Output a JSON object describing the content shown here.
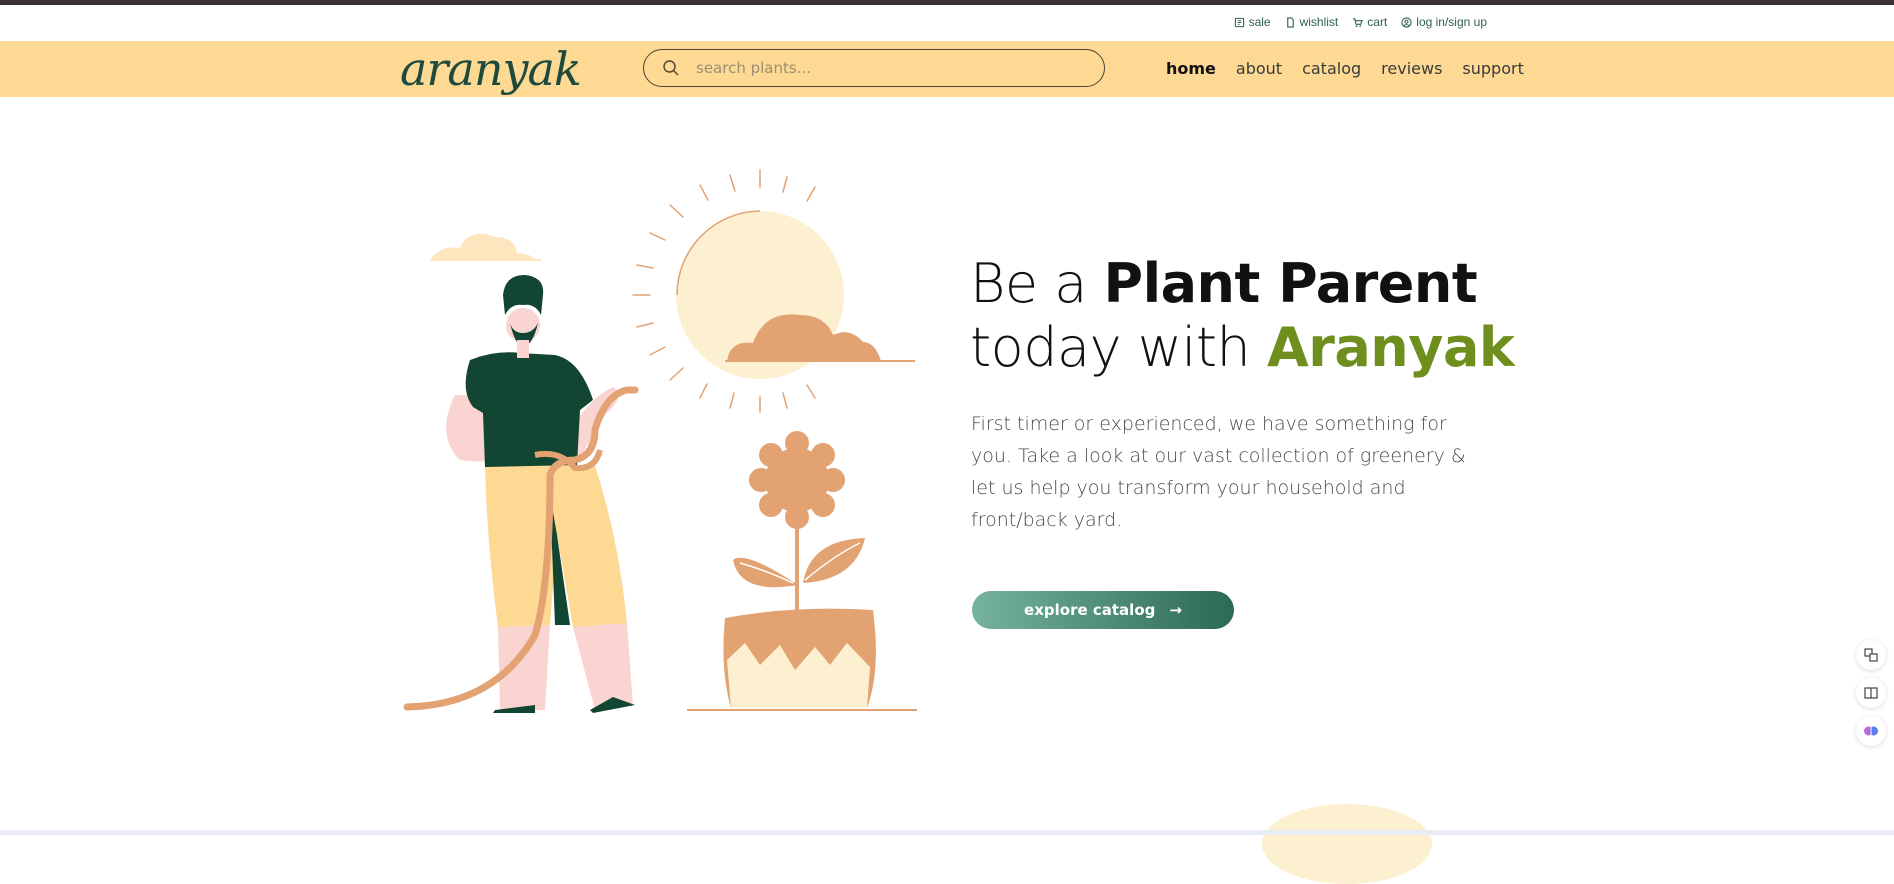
{
  "utility": {
    "links": [
      {
        "label": "sale",
        "icon": "tag-icon"
      },
      {
        "label": "wishlist",
        "icon": "document-icon"
      },
      {
        "label": "cart",
        "icon": "cart-icon"
      },
      {
        "label": "log in/sign up",
        "icon": "user-circle-icon"
      }
    ]
  },
  "navbar": {
    "logo": "aranyak",
    "search_placeholder": "search plants...",
    "links": [
      "home",
      "about",
      "catalog",
      "reviews",
      "support"
    ],
    "active": "home"
  },
  "hero": {
    "headline_line1_plain": "Be a ",
    "headline_line1_bold": "Plant Parent",
    "headline_line2_plain": "today with ",
    "headline_line2_brand": "Aranyak",
    "description": "First timer or experienced, we have something for you. Take a look at our vast collection of greenery & let us help you transform your household and front/back yard.",
    "cta_label": "explore catalog"
  },
  "colors": {
    "navbar_bg": "#fdd993",
    "brand_green": "#1d4a3c",
    "accent_olive": "#6e8f1e",
    "illustration_peach": "#e2a272",
    "cta_start": "#76b39f",
    "cta_end": "#2c6a55"
  }
}
